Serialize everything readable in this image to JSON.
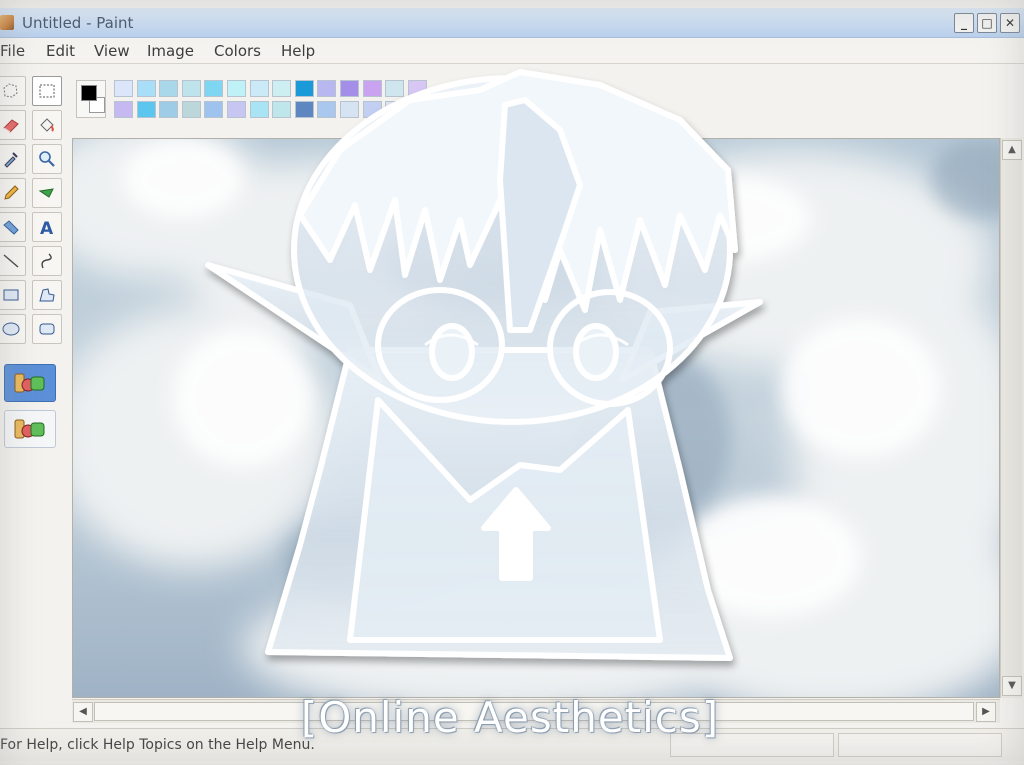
{
  "window": {
    "title": "Untitled - Paint",
    "minimize_glyph": "_",
    "maximize_glyph": "□",
    "close_glyph": "✕"
  },
  "menu": [
    "File",
    "Edit",
    "View",
    "Image",
    "Colors",
    "Help"
  ],
  "toolbox": {
    "tools": [
      "free-form-select-icon",
      "select-icon",
      "eraser-icon",
      "fill-with-color-icon",
      "pick-color-icon",
      "magnifier-icon",
      "pencil-icon",
      "airbrush-icon",
      "brush-icon",
      "text-icon",
      "line-icon",
      "curve-icon",
      "rectangle-icon",
      "polygon-icon",
      "ellipse-icon",
      "rounded-rectangle-icon"
    ],
    "active_tool": "select-icon",
    "options": [
      "transparent-option-icon",
      "opaque-option-icon"
    ]
  },
  "palette": {
    "foreground": "#000000",
    "background": "#ffffff",
    "row1": [
      "#dbe6fb",
      "#a8def7",
      "#a9d8ea",
      "#bfe3ea",
      "#7ed6f2",
      "#bff2f6",
      "#c9eaf6",
      "#cdeff2",
      "#1b9ad9",
      "#b9b7f0",
      "#a58ee8",
      "#c9a2f0",
      "#cfe6ef",
      "#d8c6f4"
    ],
    "row2": [
      "#c6b9f2",
      "#5cc6ee",
      "#9ecbe6",
      "#bcd7da",
      "#9ec3ef",
      "#c7c6f2",
      "#a9e4f4",
      "#bfe6ea",
      "#5e86c0",
      "#aac7ee",
      "#d5e3f2",
      "#c2cff2",
      "#dfe3f1",
      "#b8c4e6"
    ]
  },
  "statusbar": {
    "help_text": "For Help, click Help Topics on the Help Menu."
  },
  "watermark": "[Online Aesthetics]"
}
